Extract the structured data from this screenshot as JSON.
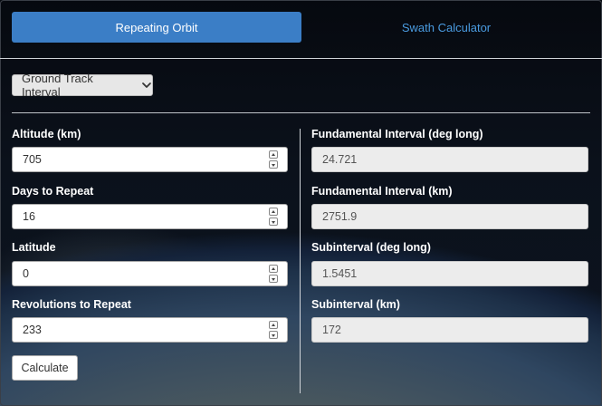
{
  "tabs": [
    {
      "label": "Repeating Orbit",
      "active": true
    },
    {
      "label": "Swath Calculator",
      "active": false
    }
  ],
  "mode_select": {
    "value": "Ground Track Interval",
    "icon": "chevron-down-icon"
  },
  "inputs": [
    {
      "label": "Altitude (km)",
      "value": "705"
    },
    {
      "label": "Days to Repeat",
      "value": "16"
    },
    {
      "label": "Latitude",
      "value": "0"
    },
    {
      "label": "Revolutions to Repeat",
      "value": "233"
    }
  ],
  "outputs": [
    {
      "label": "Fundamental Interval (deg long)",
      "value": "24.721"
    },
    {
      "label": "Fundamental Interval (km)",
      "value": "2751.9"
    },
    {
      "label": "Subinterval (deg long)",
      "value": "1.5451"
    },
    {
      "label": "Subinterval (km)",
      "value": "172"
    }
  ],
  "calculate_label": "Calculate",
  "colors": {
    "accent": "#3b7ec6",
    "link": "#4a9be0"
  }
}
